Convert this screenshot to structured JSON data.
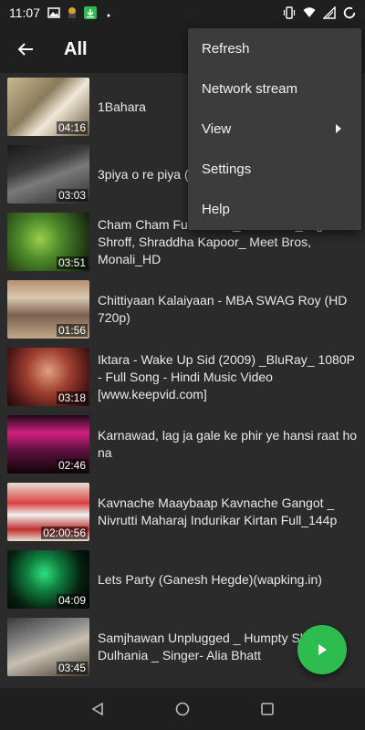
{
  "status_bar": {
    "time": "11:07"
  },
  "app_bar": {
    "title": "All"
  },
  "menu": {
    "items": [
      "Refresh",
      "Network stream",
      "View",
      "Settings",
      "Help"
    ]
  },
  "videos": [
    {
      "title": "1Bahara",
      "duration": "04:16"
    },
    {
      "title": "3piya o re piya (",
      "duration": "03:03"
    },
    {
      "title": "Cham Cham Full Video _ BAAGHI _ Tiger Shroff, Shraddha Kapoor_ Meet Bros, Monali_HD",
      "duration": "03:51"
    },
    {
      "title": "Chittiyaan Kalaiyaan - MBA SWAG Roy (HD 720p)",
      "duration": "01:56"
    },
    {
      "title": "Iktara - Wake Up Sid (2009) _BluRay_ 1080P - Full Song - Hindi Music Video [www.keepvid.com]",
      "duration": "03:18"
    },
    {
      "title": "Karnawad, lag ja gale ke phir ye hansi raat ho na",
      "duration": "02:46"
    },
    {
      "title": "Kavnache Maaybaap Kavnache Gangot _ Nivrutti Maharaj Indurikar Kirtan Full_144p",
      "duration": "02:00:56"
    },
    {
      "title": "Lets Party (Ganesh Hegde)(wapking.in)",
      "duration": "04:09"
    },
    {
      "title": "Samjhawan Unplugged _ Humpty Sh Dulhania _ Singer- Alia Bhatt",
      "duration": "03:45"
    }
  ],
  "colors": {
    "accent": "#2ebc4f",
    "background": "#2b2b2b",
    "menu_bg": "#3c3c3c"
  },
  "icons": [
    "back-arrow-icon",
    "play-icon",
    "submenu-arrow-icon",
    "nav-back-icon",
    "nav-home-icon",
    "nav-recents-icon"
  ]
}
